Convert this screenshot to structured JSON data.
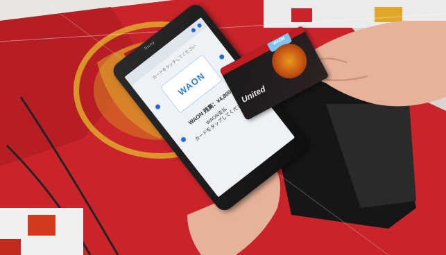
{
  "colors": {
    "flag_red": "#c8242a",
    "flag_gold": "#e0a82a",
    "bag_black": "#161616",
    "phone": "#1a1a1a",
    "waon_blue": "#2f7fd6",
    "skin": "#e7b29a"
  },
  "phone": {
    "brand": "Sony",
    "header": "カードをタッチしてください",
    "waon_logo": "WAON",
    "balance": "WAON 残高：¥4,800",
    "message_line1": "WAON支払",
    "message_line2": "カードをタップしてください"
  },
  "card": {
    "waon_tag": "WAON",
    "team": "United"
  }
}
